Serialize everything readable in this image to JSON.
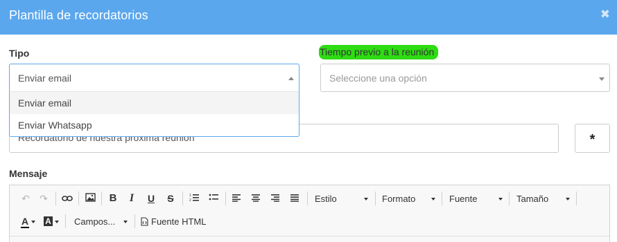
{
  "dialog": {
    "title": "Plantilla de recordatorios",
    "close_glyph": "✖"
  },
  "tipo": {
    "label": "Tipo",
    "value": "Enviar email",
    "options": [
      "Enviar email",
      "Enviar Whatsapp"
    ]
  },
  "tiempo": {
    "label": "Tiempo previo a la reunión",
    "placeholder": "Seleccione una opción",
    "highlight_color": "#2edc12"
  },
  "asunto": {
    "value": "Recordatorio de nuestra próxima reunión",
    "button_label": "*"
  },
  "mensaje": {
    "label": "Mensaje",
    "toolbar": {
      "undo_icon": "↶",
      "redo_icon": "↷",
      "bold": "B",
      "italic": "I",
      "underline": "U",
      "strike": "S",
      "style": "Estilo",
      "format": "Formato",
      "font": "Fuente",
      "size": "Tamaño",
      "text_color": "A",
      "bg_color": "A",
      "fields": "Campos...",
      "html_source": "Fuente HTML"
    }
  },
  "colors": {
    "header": "#5aa7ee",
    "focus_border": "#5aa7ee"
  }
}
